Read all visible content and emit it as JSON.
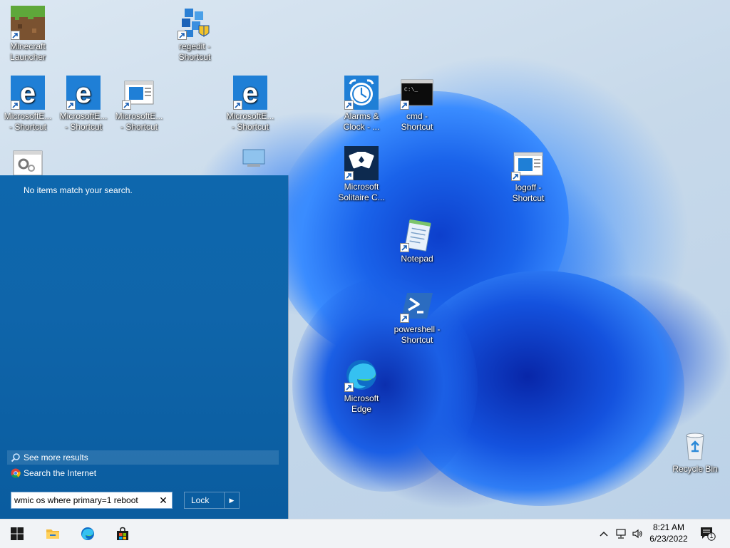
{
  "desktop": {
    "icons": [
      {
        "id": "minecraft",
        "line1": "Minecraft",
        "line2": "Launcher"
      },
      {
        "id": "regedit",
        "line1": "regedit -",
        "line2": "Shortcut"
      },
      {
        "id": "edge1",
        "line1": "MicrosoftE...",
        "line2": "- Shortcut"
      },
      {
        "id": "edge2",
        "line1": "MicrosoftE...",
        "line2": "- Shortcut"
      },
      {
        "id": "edge3",
        "line1": "MicrosoftE...",
        "line2": "- Shortcut"
      },
      {
        "id": "edge4",
        "line1": "MicrosoftE...",
        "line2": "- Shortcut"
      },
      {
        "id": "alarms",
        "line1": "Alarms &",
        "line2": "Clock - ..."
      },
      {
        "id": "cmd",
        "line1": "cmd -",
        "line2": "Shortcut"
      },
      {
        "id": "solitaire",
        "line1": "Microsoft",
        "line2": "Solitaire C..."
      },
      {
        "id": "logoff",
        "line1": "logoff -",
        "line2": "Shortcut"
      },
      {
        "id": "notepad",
        "line1": "Notepad",
        "line2": ""
      },
      {
        "id": "powershell",
        "line1": "powershell -",
        "line2": "Shortcut"
      },
      {
        "id": "msedge",
        "line1": "Microsoft",
        "line2": "Edge"
      },
      {
        "id": "recycle",
        "line1": "Recycle Bin",
        "line2": ""
      }
    ]
  },
  "start": {
    "no_items": "No items match your search.",
    "see_more": "See more results",
    "search_internet": "Search the Internet",
    "search_value": "wmic os where primary=1 reboot",
    "lock_label": "Lock",
    "lock_arrow": "▶"
  },
  "taskbar": {
    "time": "8:21 AM",
    "date": "6/23/2022",
    "notification_count": "1"
  }
}
